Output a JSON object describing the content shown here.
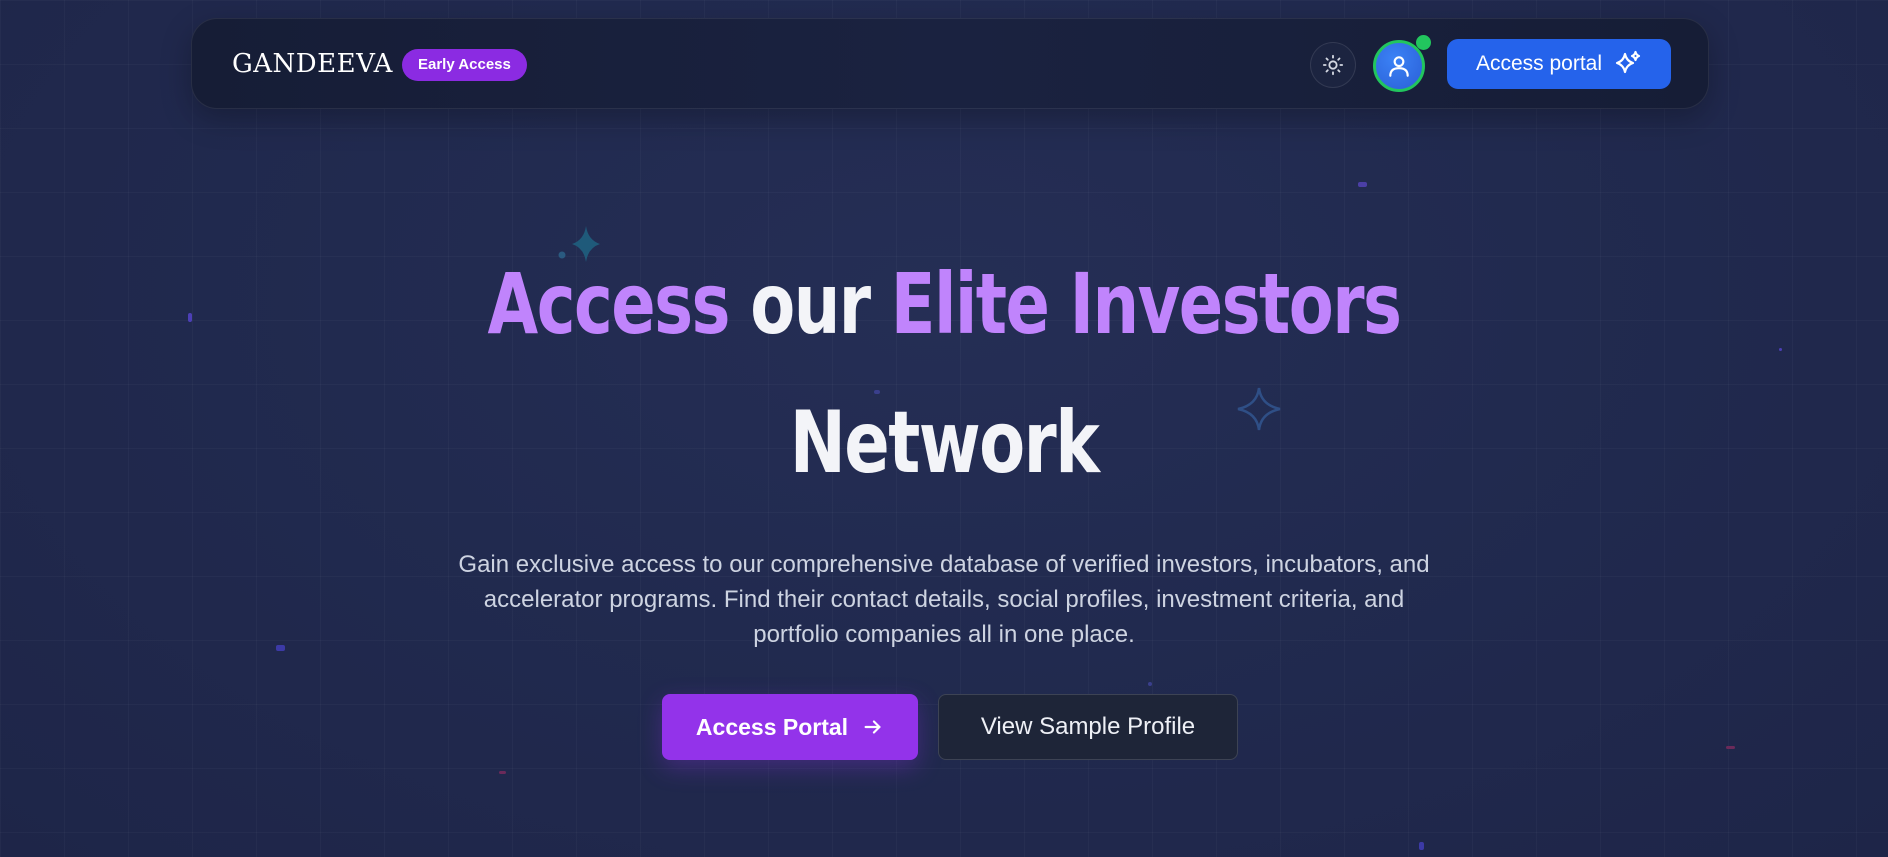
{
  "navbar": {
    "logo_text": "GANDEEVA",
    "badge": "Early Access",
    "theme_toggle_icon": "sun-icon",
    "avatar_icon": "user-icon",
    "cta_label": "Access portal",
    "cta_icon": "sparkles-icon"
  },
  "hero": {
    "title_word_1": "Access",
    "title_word_2": "our",
    "title_word_3": "Elite Investors",
    "title_line_2": "Network",
    "description": "Gain exclusive access to our comprehensive database of verified investors, incubators, and accelerator programs. Find their contact details, social profiles, investment criteria, and portfolio companies all in one place.",
    "primary_button": "Access Portal",
    "primary_button_icon": "arrow-right-icon",
    "secondary_button": "View Sample Profile"
  },
  "colors": {
    "accent_purple": "#c084fc",
    "badge_purple": "#8b2be2",
    "primary_button": "#9333ea",
    "nav_cta_blue": "#2563eb",
    "online_green": "#22c55e",
    "background": "#212a4f"
  }
}
